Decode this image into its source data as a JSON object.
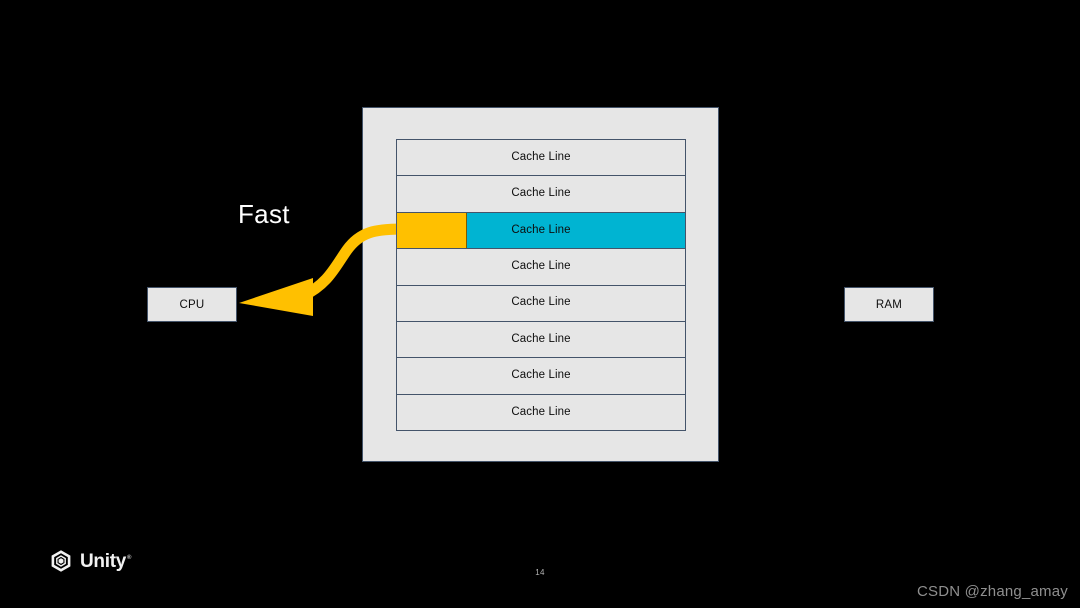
{
  "slide": {
    "background_color": "#000000",
    "number": "14"
  },
  "fast_label": {
    "text": "Fast"
  },
  "cpu": {
    "label": "CPU"
  },
  "ram": {
    "label": "RAM"
  },
  "cache": {
    "panel_fill": "#e6e6e6",
    "border_color": "#44546a",
    "highlight_color": "#00b4d2",
    "chunk_color": "#ffc000",
    "lines": [
      {
        "label": "Cache Line",
        "highlighted": false,
        "has_chunk": false
      },
      {
        "label": "Cache Line",
        "highlighted": false,
        "has_chunk": false
      },
      {
        "label": "Cache Line",
        "highlighted": true,
        "has_chunk": true
      },
      {
        "label": "Cache Line",
        "highlighted": false,
        "has_chunk": false
      },
      {
        "label": "Cache Line",
        "highlighted": false,
        "has_chunk": false
      },
      {
        "label": "Cache Line",
        "highlighted": false,
        "has_chunk": false
      },
      {
        "label": "Cache Line",
        "highlighted": false,
        "has_chunk": false
      },
      {
        "label": "Cache Line",
        "highlighted": false,
        "has_chunk": false
      }
    ]
  },
  "arrow": {
    "color": "#ffc000",
    "direction": "cache-to-cpu"
  },
  "logo": {
    "name": "Unity",
    "trademark": "®",
    "icon": "unity-cube-icon"
  },
  "watermark": {
    "text": "CSDN @zhang_amay"
  }
}
